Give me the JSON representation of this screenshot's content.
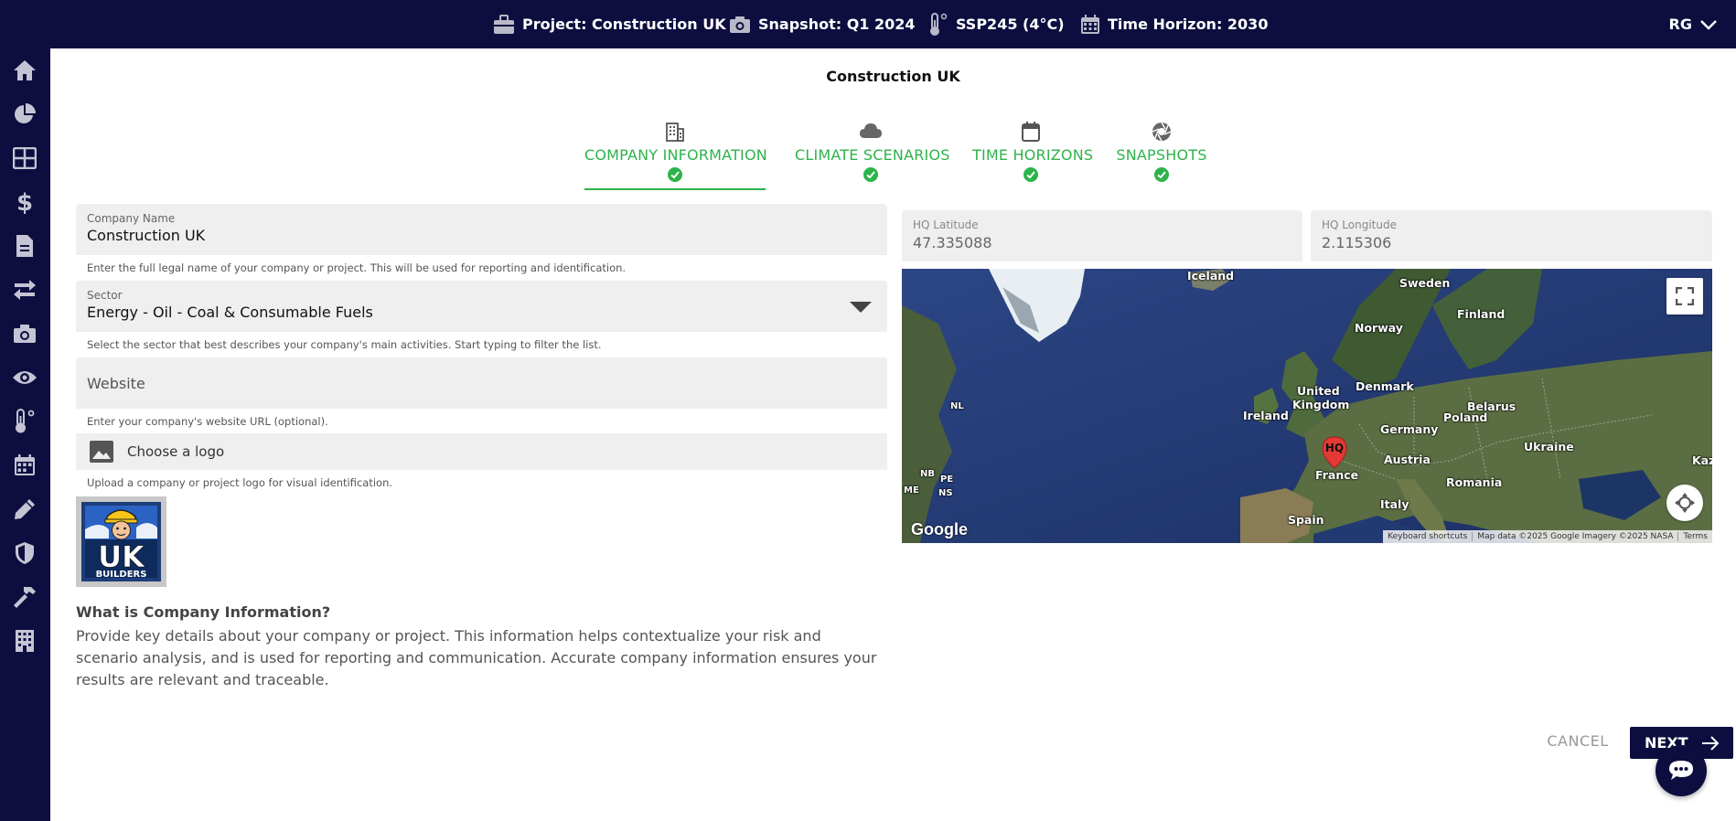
{
  "topbar": {
    "project": "Project: Construction UK",
    "snapshot": "Snapshot: Q1 2024",
    "scenario": "SSP245 (4°C)",
    "time_horizon": "Time Horizon: 2030",
    "user_initials": "RG"
  },
  "sidebar": {
    "items": [
      "home-icon",
      "pie-chart-icon",
      "grid-icon",
      "dollar-icon",
      "document-icon",
      "swap-icon",
      "camera-icon",
      "eye-icon",
      "thermometer-icon",
      "calendar-icon",
      "pencil-icon",
      "shield-icon",
      "hammer-icon",
      "building-icon"
    ]
  },
  "page": {
    "title": "Construction UK"
  },
  "steps": [
    {
      "label": "COMPANY INFORMATION",
      "icon": "building-icon"
    },
    {
      "label": "CLIMATE SCENARIOS",
      "icon": "cloud-icon"
    },
    {
      "label": "TIME HORIZONS",
      "icon": "calendar-icon"
    },
    {
      "label": "SNAPSHOTS",
      "icon": "aperture-icon"
    }
  ],
  "form": {
    "company_name": {
      "label": "Company Name",
      "value": "Construction UK",
      "helper": "Enter the full legal name of your company or project. This will be used for reporting and identification."
    },
    "sector": {
      "label": "Sector",
      "value": "Energy - Oil - Coal & Consumable Fuels",
      "helper": "Select the sector that best describes your company's main activities. Start typing to filter the list."
    },
    "website": {
      "placeholder": "Website",
      "helper": "Enter your company's website URL (optional)."
    },
    "logo": {
      "label": "Choose a logo",
      "helper": "Upload a company or project logo for visual identification.",
      "preview_line1": "UK",
      "preview_line2": "BUILDERS"
    }
  },
  "info": {
    "title": "What is Company Information?",
    "text": "Provide key details about your company or project. This information helps contextualize your risk and scenario analysis, and is used for reporting and communication. Accurate company information ensures your results are relevant and traceable."
  },
  "location": {
    "lat_label": "HQ Latitude",
    "lat_value": "47.335088",
    "lon_label": "HQ Longitude",
    "lon_value": "2.115306"
  },
  "map": {
    "labels": {
      "iceland": "Iceland",
      "sweden": "Sweden",
      "finland": "Finland",
      "norway": "Norway",
      "united_kingdom_1": "United",
      "united_kingdom_2": "Kingdom",
      "denmark": "Denmark",
      "ireland": "Ireland",
      "germany": "Germany",
      "poland": "Poland",
      "belarus": "Belarus",
      "ukraine": "Ukraine",
      "austria": "Austria",
      "france": "France",
      "romania": "Romania",
      "italy": "Italy",
      "spain": "Spain",
      "kaz": "Kaz",
      "nl": "NL",
      "nb": "NB",
      "pe": "PE",
      "ns": "NS",
      "me": "ME"
    },
    "marker": "HQ",
    "brand": "Google",
    "attribution": {
      "shortcuts": "Keyboard shortcuts",
      "data": "Map data ©2025 Google Imagery ©2025 NASA",
      "terms": "Terms"
    }
  },
  "footer": {
    "cancel": "CANCEL",
    "next": "NEXT"
  },
  "colors": {
    "navy": "#0d0e3f",
    "green": "#2db34a",
    "field_bg": "#efefef"
  }
}
